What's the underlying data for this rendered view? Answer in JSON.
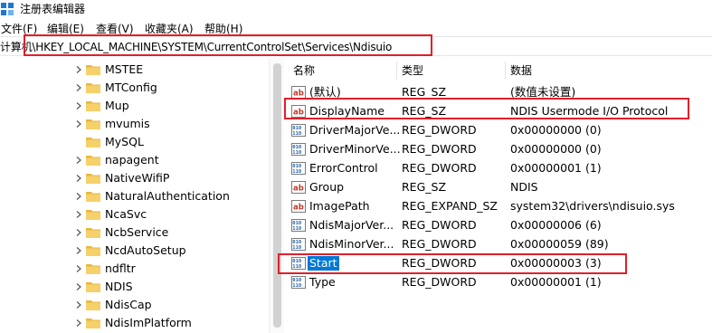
{
  "window": {
    "title": "注册表编辑器"
  },
  "menu": [
    "文件(F)",
    "编辑(E)",
    "查看(V)",
    "收藏夹(A)",
    "帮助(H)"
  ],
  "address": {
    "path": "计算机\\HKEY_LOCAL_MACHINE\\SYSTEM\\CurrentControlSet\\Services\\Ndisuio"
  },
  "tree": {
    "items": [
      "MSTEE",
      "MTConfig",
      "Mup",
      "mvumis",
      "MySQL",
      "napagent",
      "NativeWifiP",
      "NaturalAuthentication",
      "NcaSvc",
      "NcbService",
      "NcdAutoSetup",
      "ndfltr",
      "NDIS",
      "NdisCap",
      "NdisImPlatform"
    ],
    "expandable": [
      true,
      true,
      true,
      true,
      false,
      true,
      true,
      true,
      true,
      true,
      true,
      true,
      true,
      true,
      true
    ]
  },
  "values": {
    "headers": {
      "name": "名称",
      "type": "类型",
      "data": "数据"
    },
    "rows": [
      {
        "name": "(默认)",
        "type": "REG_SZ",
        "data": "(数值未设置)",
        "icon": "string-value-icon"
      },
      {
        "name": "DisplayName",
        "type": "REG_SZ",
        "data": "NDIS Usermode I/O Protocol",
        "icon": "string-value-icon"
      },
      {
        "name": "DriverMajorVe...",
        "type": "REG_DWORD",
        "data": "0x00000000 (0)",
        "icon": "binary-value-icon"
      },
      {
        "name": "DriverMinorVe...",
        "type": "REG_DWORD",
        "data": "0x00000000 (0)",
        "icon": "binary-value-icon"
      },
      {
        "name": "ErrorControl",
        "type": "REG_DWORD",
        "data": "0x00000001 (1)",
        "icon": "binary-value-icon"
      },
      {
        "name": "Group",
        "type": "REG_SZ",
        "data": "NDIS",
        "icon": "string-value-icon"
      },
      {
        "name": "ImagePath",
        "type": "REG_EXPAND_SZ",
        "data": "system32\\drivers\\ndisuio.sys",
        "icon": "string-value-icon"
      },
      {
        "name": "NdisMajorVer...",
        "type": "REG_DWORD",
        "data": "0x00000006 (6)",
        "icon": "binary-value-icon"
      },
      {
        "name": "NdisMinorVer...",
        "type": "REG_DWORD",
        "data": "0x00000059 (89)",
        "icon": "binary-value-icon"
      },
      {
        "name": "Start",
        "type": "REG_DWORD",
        "data": "0x00000003 (3)",
        "icon": "binary-value-icon",
        "selected": true
      },
      {
        "name": "Type",
        "type": "REG_DWORD",
        "data": "0x00000001 (1)",
        "icon": "binary-value-icon"
      }
    ]
  },
  "colors": {
    "highlight_border": "#e0202a",
    "selection": "#0078d7",
    "folder": "#f0c24a"
  }
}
